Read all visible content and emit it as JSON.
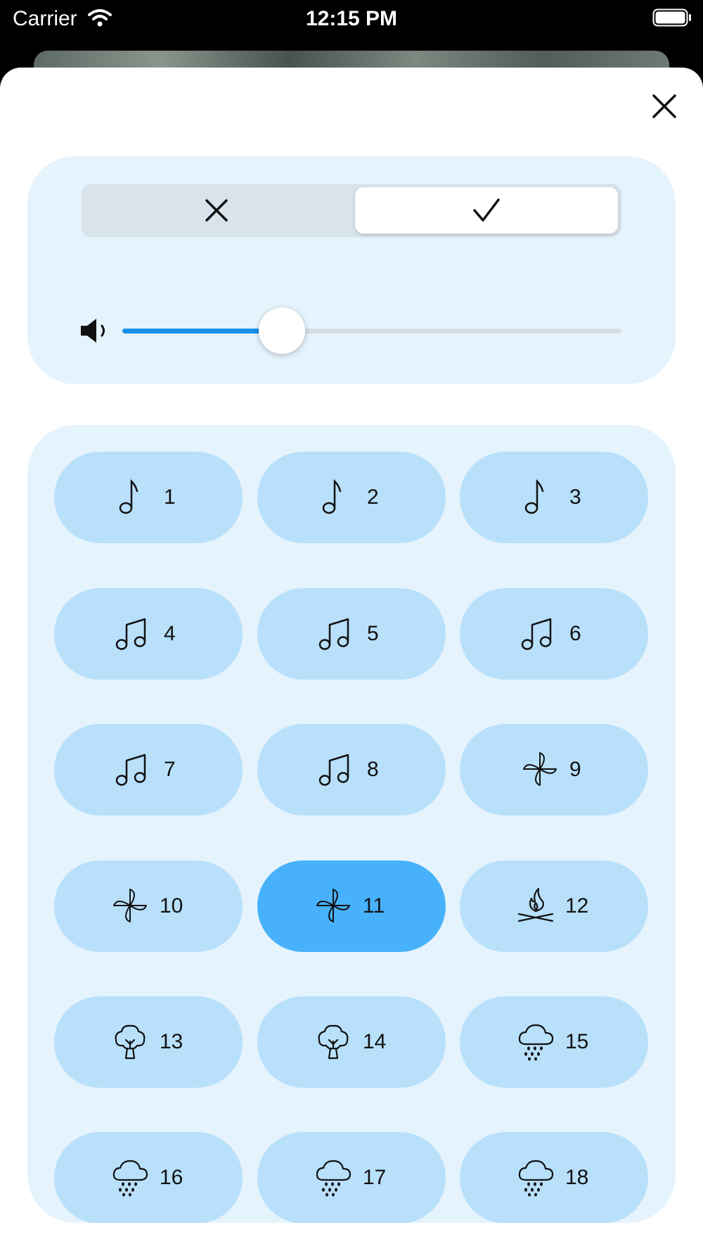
{
  "status_bar": {
    "carrier": "Carrier",
    "time": "12:15 PM"
  },
  "sheet": {
    "close_icon": "close-icon"
  },
  "controls": {
    "toggle": {
      "off_icon": "x-icon",
      "on_icon": "checkmark-icon",
      "selected": "on"
    },
    "volume": {
      "icon": "speaker-icon",
      "level": 0.32,
      "accent_color": "#1a8fe8"
    }
  },
  "sounds": {
    "pill_color": "#b8e0fb",
    "selected_color": "#47b2fb",
    "selected_index": 10,
    "items": [
      {
        "label": "1",
        "icon": "music-note-icon"
      },
      {
        "label": "2",
        "icon": "music-note-icon"
      },
      {
        "label": "3",
        "icon": "music-note-icon"
      },
      {
        "label": "4",
        "icon": "music-notes-icon"
      },
      {
        "label": "5",
        "icon": "music-notes-icon"
      },
      {
        "label": "6",
        "icon": "music-notes-icon"
      },
      {
        "label": "7",
        "icon": "music-notes-icon"
      },
      {
        "label": "8",
        "icon": "music-notes-icon"
      },
      {
        "label": "9",
        "icon": "fan-icon"
      },
      {
        "label": "10",
        "icon": "fan-icon"
      },
      {
        "label": "11",
        "icon": "fan-icon"
      },
      {
        "label": "12",
        "icon": "campfire-icon"
      },
      {
        "label": "13",
        "icon": "tree-icon"
      },
      {
        "label": "14",
        "icon": "tree-icon"
      },
      {
        "label": "15",
        "icon": "rain-cloud-icon"
      },
      {
        "label": "16",
        "icon": "rain-cloud-icon"
      },
      {
        "label": "17",
        "icon": "rain-cloud-icon"
      },
      {
        "label": "18",
        "icon": "rain-cloud-icon"
      }
    ]
  }
}
